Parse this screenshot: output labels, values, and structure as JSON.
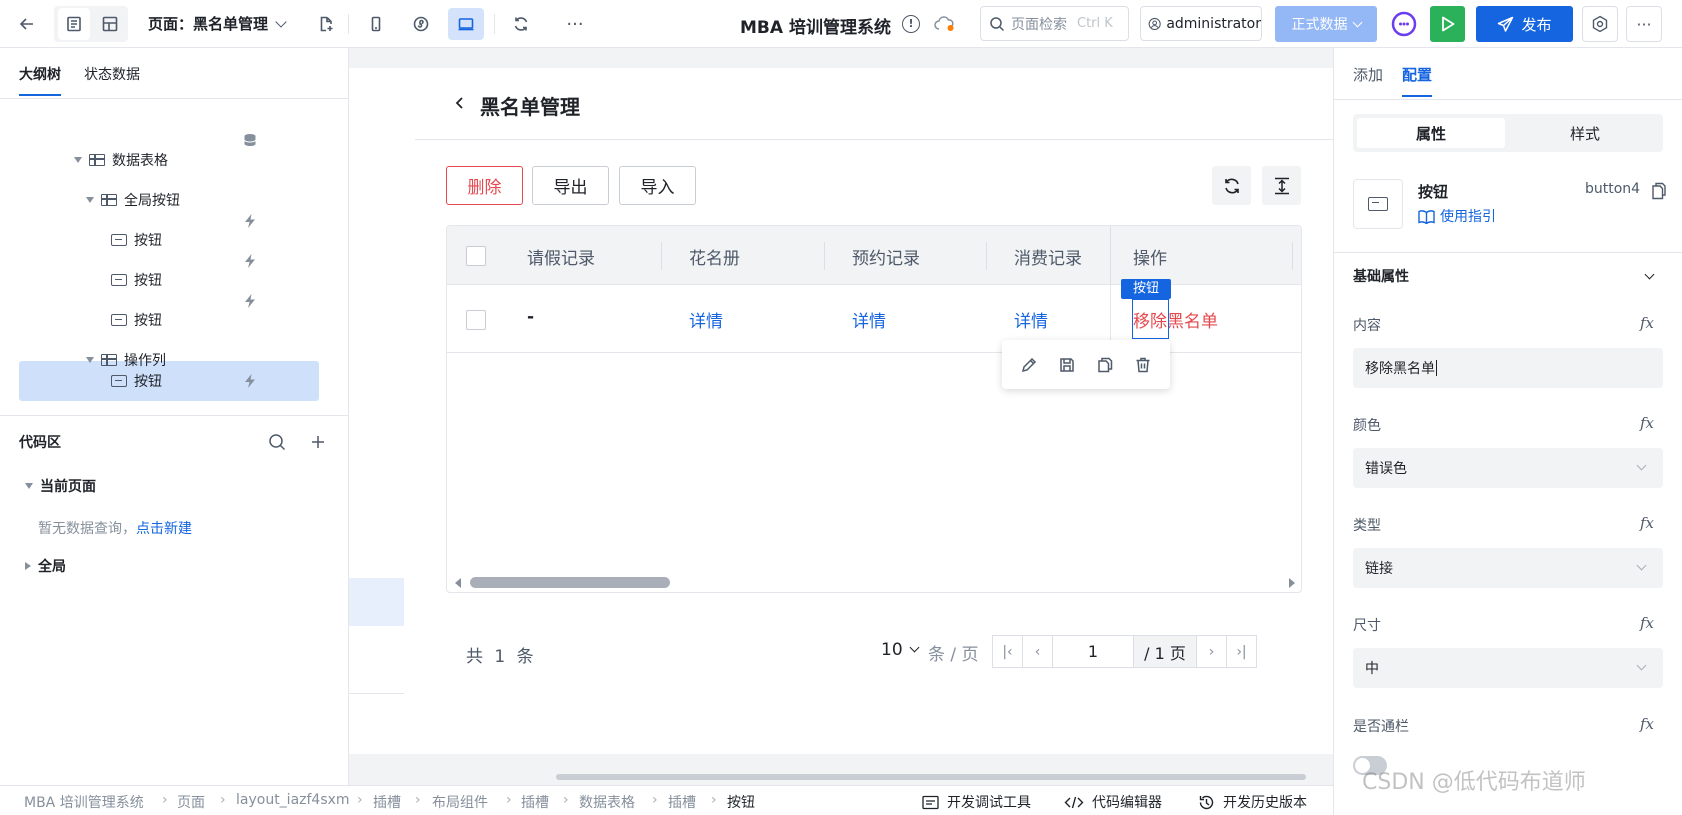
{
  "topbar": {
    "page_label": "页面：黑名单管理",
    "app_title": "MBA 培训管理系统",
    "search_placeholder": "页面检索",
    "search_shortcut": "Ctrl K",
    "user_name": "administrator",
    "env_label": "正式数据",
    "publish_label": "发布"
  },
  "left": {
    "tabs": [
      "大纲树",
      "状态数据"
    ],
    "tree": [
      {
        "label": "数据表格",
        "kind": "table"
      },
      {
        "label": "全局按钮",
        "kind": "table"
      },
      {
        "label": "按钮",
        "kind": "button"
      },
      {
        "label": "按钮",
        "kind": "button"
      },
      {
        "label": "按钮",
        "kind": "button"
      },
      {
        "label": "操作列",
        "kind": "table"
      },
      {
        "label": "按钮",
        "kind": "button"
      }
    ],
    "code_title": "代码区",
    "current_page": "当前页面",
    "empty_text": "暂无数据查询，",
    "create_link": "点击新建",
    "global": "全局"
  },
  "page": {
    "title": "黑名单管理",
    "buttons": {
      "delete": "删除",
      "export": "导出",
      "import": "导入"
    },
    "columns": [
      "请假记录",
      "花名册",
      "预约记录",
      "消费记录",
      "操作"
    ],
    "rows": [
      {
        "leave": "-",
        "roster": "详情",
        "booking": "详情",
        "consume": "详情",
        "action": "移除黑名单"
      }
    ],
    "selection_tag": "按钮",
    "pager": {
      "total_prefix": "共",
      "total": "1",
      "total_suffix": "条",
      "page_size": "10",
      "per_page": "条 / 页",
      "current": "1",
      "pages": "/ 1 页"
    }
  },
  "right": {
    "tabs": [
      "添加",
      "配置"
    ],
    "segments": [
      "属性",
      "样式"
    ],
    "component_name": "按钮",
    "component_id": "button4",
    "guide_link": "使用指引",
    "section": "基础属性",
    "props": [
      {
        "label": "内容",
        "value": "移除黑名单",
        "type": "input"
      },
      {
        "label": "颜色",
        "value": "错误色",
        "type": "select"
      },
      {
        "label": "类型",
        "value": "链接",
        "type": "select"
      },
      {
        "label": "尺寸",
        "value": "中",
        "type": "select"
      }
    ],
    "toggle_label": "是否通栏",
    "fx_symbol": "fx"
  },
  "status": {
    "breadcrumb": [
      "MBA 培训管理系统",
      "页面",
      "layout_iazf4sxm",
      "插槽",
      "布局组件",
      "插槽",
      "数据表格",
      "插槽",
      "按钮"
    ],
    "tools": [
      "开发调试工具",
      "代码编辑器",
      "开发历史版本"
    ]
  },
  "watermark": "CSDN @低代码布道师",
  "colors": {
    "primary": "#1565e0",
    "danger": "#e5484d",
    "success": "#2bb15a",
    "selected": "#cfe0fb"
  }
}
